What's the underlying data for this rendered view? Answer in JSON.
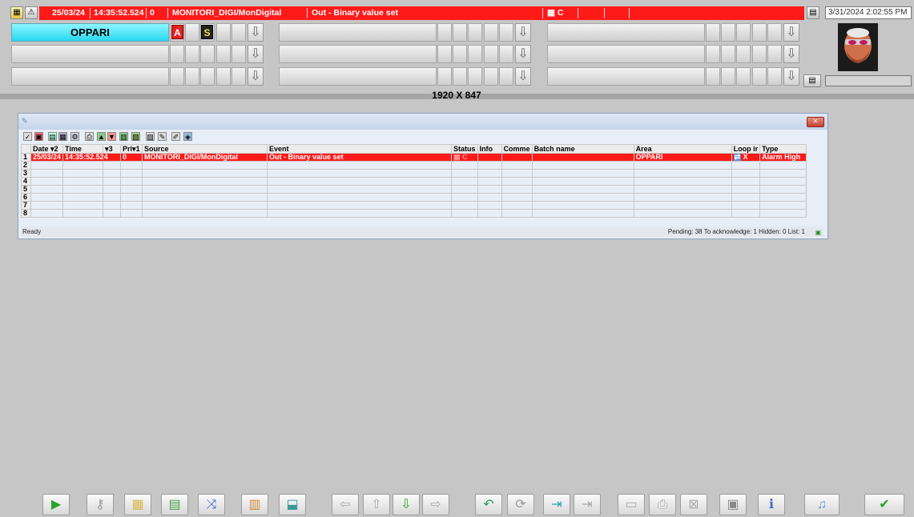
{
  "alarm_line": {
    "date": "25/03/24",
    "time": "14:35:52.524",
    "priority": "0",
    "source": "MONITORI_DIGI/MonDigital",
    "event": "Out - Binary value set",
    "status": "C"
  },
  "datetime": "3/31/2024 2:02:55 PM",
  "areas": {
    "row1_name": "OPPARI",
    "badge_a": "A",
    "badge_s": "S"
  },
  "resolution": "1920 X 847",
  "grid": {
    "headers": [
      "",
      "Date ▾2",
      "Time",
      "▾3",
      "Pri▾1",
      "Source",
      "Event",
      "Status",
      "Info",
      "Comme",
      "Batch name",
      "Area",
      "Loop ir",
      "Type"
    ],
    "alarm_row": {
      "num": "1",
      "date": "25/03/24",
      "time": "14:35:52.524",
      "priority": "0",
      "source": "MONITORI_DIGI/MonDigital",
      "event": "Out - Binary value set",
      "status": "C",
      "area": "OPPARI",
      "loop": "X",
      "type": "Alarm High"
    },
    "empty_rows": [
      "2",
      "3",
      "4",
      "5",
      "6",
      "7",
      "8"
    ]
  },
  "statusbar": {
    "state": "Ready",
    "counts": "Pending: 38   To acknowledge: 1   Hidden: 0   List: 1"
  },
  "colors": {
    "alarm_red": "#ff1a1a",
    "area_cyan": "#28d8f0",
    "background": "#c6c6c6"
  },
  "bottom_toolbar": [
    "play-icon",
    "key-icon",
    "folder-icon",
    "report-icon",
    "trend-icon",
    "thermometer-icon",
    "upload-icon",
    "arrow-left-icon",
    "arrow-up-icon",
    "arrow-down-icon",
    "arrow-right-icon",
    "undo-icon",
    "refresh-icon",
    "import-icon",
    "export-icon",
    "window-icon",
    "print-screen-icon",
    "close-window-icon",
    "screen-icon",
    "info-icon",
    "sound-icon",
    "acknowledge-icon"
  ]
}
